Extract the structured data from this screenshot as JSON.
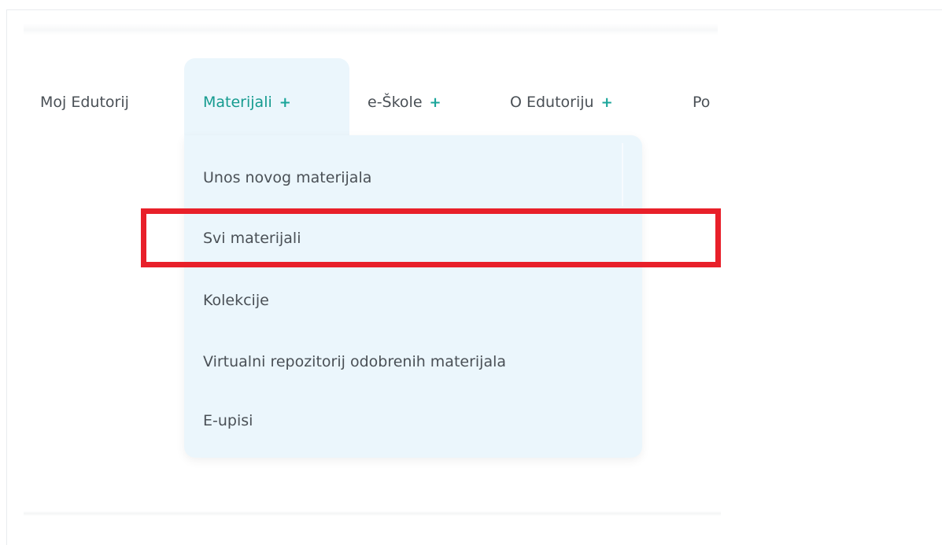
{
  "nav": {
    "items": [
      {
        "label": "Moj Edutorij",
        "plus": ""
      },
      {
        "label": "Materijali",
        "plus": "+"
      },
      {
        "label": "e-Škole",
        "plus": "+"
      },
      {
        "label": "O Edutoriju",
        "plus": "+"
      },
      {
        "label": "Po",
        "plus": ""
      }
    ]
  },
  "dropdown": {
    "items": [
      {
        "label": "Unos novog materijala"
      },
      {
        "label": "Svi materijali"
      },
      {
        "label": "Kolekcije"
      },
      {
        "label": "Virtualni repozitorij odobrenih materijala"
      },
      {
        "label": "E-upisi"
      }
    ]
  },
  "colors": {
    "accent": "#159b8f",
    "plus": "#1aa59a",
    "dropdown_bg": "#ebf6fc",
    "highlight": "#e8202a",
    "text": "#4a5056"
  }
}
